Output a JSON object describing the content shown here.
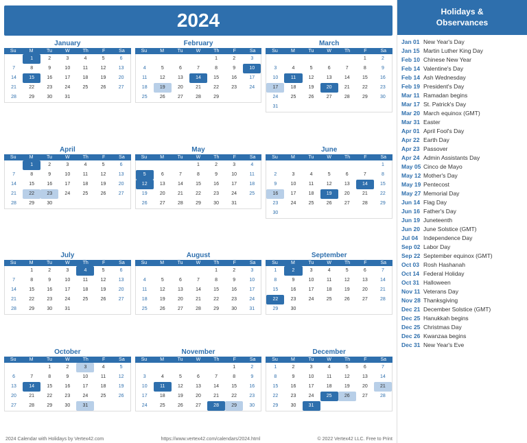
{
  "header": {
    "year": "2024",
    "sidebar_title": "Holidays &\nObservances"
  },
  "months": [
    {
      "name": "January",
      "offset": 1,
      "days": 31,
      "highlights": [
        1,
        15
      ],
      "highlight_light": [],
      "sundays": [
        7,
        14,
        21,
        28
      ],
      "saturdays": [
        6,
        13,
        20,
        27
      ]
    },
    {
      "name": "February",
      "offset": 4,
      "days": 29,
      "highlights": [
        10,
        14
      ],
      "highlight_light": [
        19
      ],
      "sundays": [
        4,
        11,
        18,
        25
      ],
      "saturdays": [
        3,
        10,
        17,
        24
      ]
    },
    {
      "name": "March",
      "offset": 5,
      "days": 31,
      "highlights": [
        11,
        20
      ],
      "highlight_light": [
        17
      ],
      "sundays": [
        3,
        10,
        17,
        24,
        31
      ],
      "saturdays": [
        2,
        9,
        16,
        23,
        30
      ]
    },
    {
      "name": "April",
      "offset": 1,
      "days": 30,
      "highlights": [
        1
      ],
      "highlight_light": [
        22,
        23
      ],
      "sundays": [
        7,
        14,
        21,
        28
      ],
      "saturdays": [
        6,
        13,
        20,
        27
      ]
    },
    {
      "name": "May",
      "offset": 3,
      "days": 31,
      "highlights": [
        5,
        12
      ],
      "highlight_light": [],
      "sundays": [
        5,
        12,
        19,
        26
      ],
      "saturdays": [
        4,
        11,
        18,
        25
      ]
    },
    {
      "name": "June",
      "offset": 6,
      "days": 30,
      "highlights": [
        14,
        19
      ],
      "highlight_light": [
        16
      ],
      "sundays": [
        2,
        9,
        16,
        23,
        30
      ],
      "saturdays": [
        1,
        8,
        15,
        22,
        29
      ]
    },
    {
      "name": "July",
      "offset": 1,
      "days": 31,
      "highlights": [
        4
      ],
      "highlight_light": [],
      "sundays": [
        7,
        14,
        21,
        28
      ],
      "saturdays": [
        6,
        13,
        20,
        27
      ]
    },
    {
      "name": "August",
      "offset": 4,
      "days": 31,
      "highlights": [],
      "highlight_light": [],
      "sundays": [
        4,
        11,
        18,
        25
      ],
      "saturdays": [
        3,
        10,
        17,
        24,
        31
      ]
    },
    {
      "name": "September",
      "offset": 0,
      "days": 30,
      "highlights": [
        2,
        22
      ],
      "highlight_light": [],
      "sundays": [
        1,
        8,
        15,
        22,
        29
      ],
      "saturdays": [
        7,
        14,
        21,
        28
      ]
    },
    {
      "name": "October",
      "offset": 2,
      "days": 31,
      "highlights": [
        14
      ],
      "highlight_light": [
        3,
        31
      ],
      "sundays": [
        6,
        13,
        20,
        27
      ],
      "saturdays": [
        5,
        12,
        19,
        26
      ]
    },
    {
      "name": "November",
      "offset": 5,
      "days": 30,
      "highlights": [
        11,
        28
      ],
      "highlight_light": [
        29
      ],
      "sundays": [
        3,
        10,
        17,
        24
      ],
      "saturdays": [
        2,
        9,
        16,
        23,
        30
      ]
    },
    {
      "name": "December",
      "offset": 0,
      "days": 31,
      "highlights": [
        25,
        31
      ],
      "highlight_light": [
        21,
        26
      ],
      "sundays": [
        1,
        8,
        15,
        22,
        29
      ],
      "saturdays": [
        7,
        14,
        21,
        28
      ]
    }
  ],
  "day_headers": [
    "Su",
    "M",
    "Tu",
    "W",
    "Th",
    "F",
    "Sa"
  ],
  "holidays": [
    {
      "date": "Jan 01",
      "name": "New Year's Day"
    },
    {
      "date": "Jan 15",
      "name": "Martin Luther King Day"
    },
    {
      "date": "Feb 10",
      "name": "Chinese New Year"
    },
    {
      "date": "Feb 14",
      "name": "Valentine's Day"
    },
    {
      "date": "Feb 14",
      "name": "Ash Wednesday"
    },
    {
      "date": "Feb 19",
      "name": "President's Day"
    },
    {
      "date": "Mar 11",
      "name": "Ramadan begins"
    },
    {
      "date": "Mar 17",
      "name": "St. Patrick's Day"
    },
    {
      "date": "Mar 20",
      "name": "March equinox (GMT)"
    },
    {
      "date": "Mar 31",
      "name": "Easter"
    },
    {
      "date": "Apr 01",
      "name": "April Fool's Day"
    },
    {
      "date": "Apr 22",
      "name": "Earth Day"
    },
    {
      "date": "Apr 23",
      "name": "Passover"
    },
    {
      "date": "Apr 24",
      "name": "Admin Assistants Day"
    },
    {
      "date": "May 05",
      "name": "Cinco de Mayo"
    },
    {
      "date": "May 12",
      "name": "Mother's Day"
    },
    {
      "date": "May 19",
      "name": "Pentecost"
    },
    {
      "date": "May 27",
      "name": "Memorial Day"
    },
    {
      "date": "Jun 14",
      "name": "Flag Day"
    },
    {
      "date": "Jun 16",
      "name": "Father's Day"
    },
    {
      "date": "Jun 19",
      "name": "Juneteenth"
    },
    {
      "date": "Jun 20",
      "name": "June Solstice (GMT)"
    },
    {
      "date": "Jul 04",
      "name": "Independence Day"
    },
    {
      "date": "Sep 02",
      "name": "Labor Day"
    },
    {
      "date": "Sep 22",
      "name": "September equinox (GMT)"
    },
    {
      "date": "Oct 03",
      "name": "Rosh Hashanah"
    },
    {
      "date": "Oct 14",
      "name": "Federal Holiday"
    },
    {
      "date": "Oct 31",
      "name": "Halloween"
    },
    {
      "date": "Nov 11",
      "name": "Veterans Day"
    },
    {
      "date": "Nov 28",
      "name": "Thanksgiving"
    },
    {
      "date": "Dec 21",
      "name": "December Solstice (GMT)"
    },
    {
      "date": "Dec 25",
      "name": "Hanukkah begins"
    },
    {
      "date": "Dec 25",
      "name": "Christmas Day"
    },
    {
      "date": "Dec 26",
      "name": "Kwanzaa begins"
    },
    {
      "date": "Dec 31",
      "name": "New Year's Eve"
    }
  ],
  "footer": {
    "left": "2024 Calendar with Holidays by Vertex42.com",
    "center": "https://www.vertex42.com/calendars/2024.html",
    "right": "© 2022 Vertex42 LLC. Free to Print"
  }
}
